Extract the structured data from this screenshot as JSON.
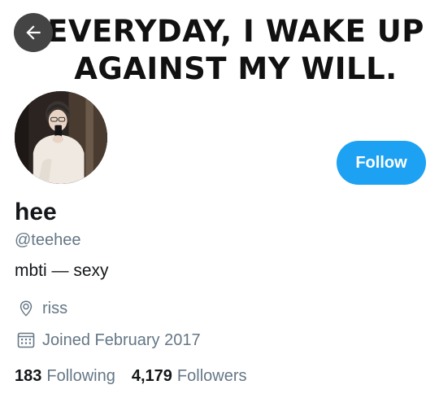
{
  "header": {
    "banner_text": "EVERYDAY, I WAKE UP\nAGAINST MY WILL.",
    "back_icon": "arrow-left-icon"
  },
  "profile": {
    "display_name": "hee",
    "handle": "@teehee",
    "bio": "mbti — sexy",
    "location": "riss",
    "joined": "Joined February 2017",
    "follow_label": "Follow",
    "following_count": "183",
    "following_label": "Following",
    "followers_count": "4,179",
    "followers_label": "Followers"
  },
  "icons": {
    "location": "location-pin-icon",
    "calendar": "calendar-icon"
  },
  "colors": {
    "accent": "#1da1f2",
    "secondary_text": "#657786",
    "primary_text": "#14171a",
    "back_button_bg": "#444444"
  }
}
